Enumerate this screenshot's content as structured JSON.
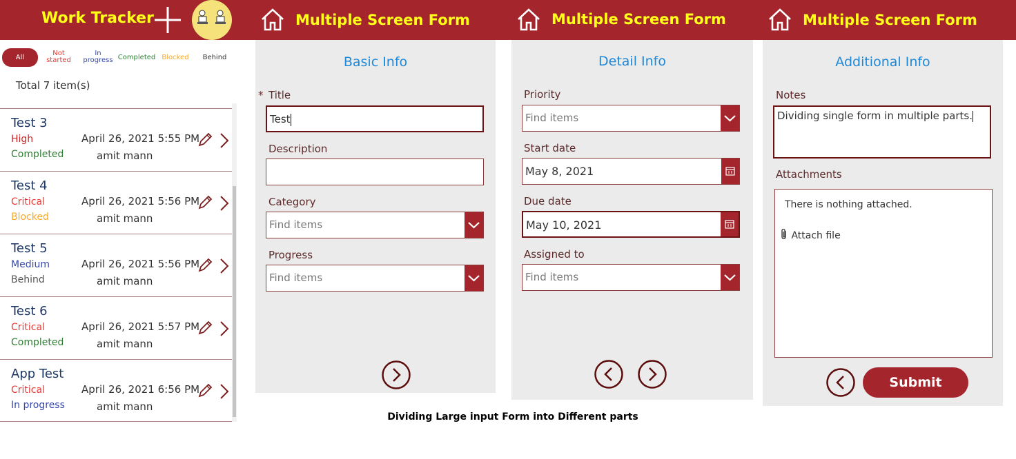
{
  "tracker": {
    "title": "Work Tracker",
    "filters": [
      {
        "label": "All",
        "color": "#ffffff"
      },
      {
        "label": "Not started",
        "color": "#e53935"
      },
      {
        "label": "In progress",
        "color": "#3949ab"
      },
      {
        "label": "Completed",
        "color": "#2e7d32"
      },
      {
        "label": "Blocked",
        "color": "#f9a825"
      },
      {
        "label": "Behind",
        "color": "#333333"
      }
    ],
    "total": "Total 7 item(s)",
    "items": [
      {
        "title": "Test 3",
        "priority": "High",
        "priority_color": "#c62828",
        "status": "Completed",
        "status_color": "#2e7d32",
        "date": "April 26, 2021 5:55 PM",
        "user": "amit mann"
      },
      {
        "title": "Test 4",
        "priority": "Critical",
        "priority_color": "#e53935",
        "status": "Blocked",
        "status_color": "#f9a825",
        "date": "April 26, 2021 5:56 PM",
        "user": "amit mann"
      },
      {
        "title": "Test 5",
        "priority": "Medium",
        "priority_color": "#3949ab",
        "status": "Behind",
        "status_color": "#555555",
        "date": "April 26, 2021 5:56 PM",
        "user": "amit mann"
      },
      {
        "title": "Test 6",
        "priority": "Critical",
        "priority_color": "#e53935",
        "status": "Completed",
        "status_color": "#2e7d32",
        "date": "April 26, 2021 5:57 PM",
        "user": "amit mann"
      },
      {
        "title": "App Test",
        "priority": "Critical",
        "priority_color": "#e53935",
        "status": "In progress",
        "status_color": "#3949ab",
        "date": "April 26, 2021 6:56 PM",
        "user": "amit mann"
      }
    ]
  },
  "form1": {
    "title": "Multiple Screen Form",
    "subtitle": "Basic Info",
    "required_mark": "*",
    "title_label": "Title",
    "title_value": "Test",
    "description_label": "Description",
    "description_value": "",
    "category_label": "Category",
    "category_placeholder": "Find items",
    "progress_label": "Progress",
    "progress_placeholder": "Find items"
  },
  "form2": {
    "title": "Multiple Screen Form",
    "subtitle": "Detail Info",
    "priority_label": "Priority",
    "priority_placeholder": "Find items",
    "start_label": "Start date",
    "start_value": "May 8, 2021",
    "due_label": "Due date",
    "due_value": "May 10, 2021",
    "assigned_label": "Assigned to",
    "assigned_placeholder": "Find items"
  },
  "form3": {
    "title": "Multiple Screen Form",
    "subtitle": "Additional Info",
    "notes_label": "Notes",
    "notes_value": "Dividing single form in multiple parts.",
    "attachments_label": "Attachments",
    "attachments_empty": "There is nothing attached.",
    "attach_label": "Attach file",
    "submit_label": "Submit"
  },
  "caption": "Dividing Large input Form into Different parts",
  "colors": {
    "brand": "#a4262c",
    "header_text": "#ffff19",
    "subtitle": "#1e88d8"
  }
}
